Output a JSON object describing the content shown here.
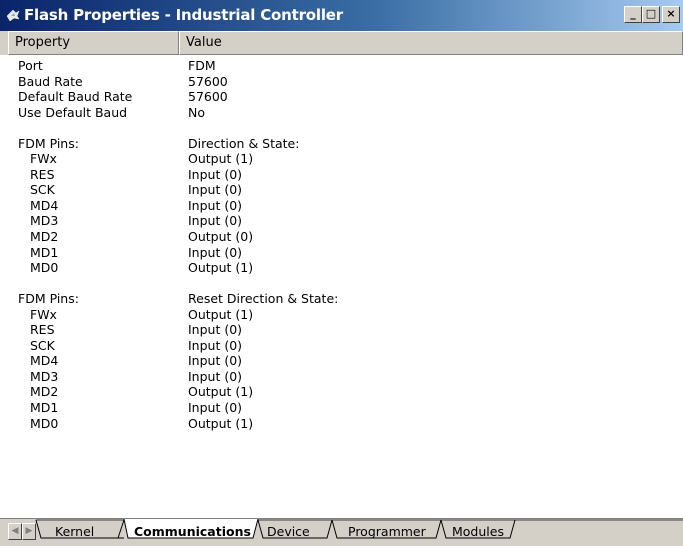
{
  "window": {
    "title": "Flash Properties - Industrial Controller"
  },
  "columns": {
    "property": "Property",
    "value": "Value"
  },
  "rows": [
    {
      "property": "Port",
      "value": "FDM"
    },
    {
      "property": "Baud Rate",
      "value": "57600"
    },
    {
      "property": "Default Baud Rate",
      "value": "57600"
    },
    {
      "property": "Use Default Baud",
      "value": "No"
    },
    {
      "property": "",
      "value": ""
    },
    {
      "property": "FDM Pins:",
      "value": "Direction & State:"
    },
    {
      "property": "FWx",
      "value": "Output (1)"
    },
    {
      "property": "RES",
      "value": "Input (0)"
    },
    {
      "property": "SCK",
      "value": "Input (0)"
    },
    {
      "property": "MD4",
      "value": "Input (0)"
    },
    {
      "property": "MD3",
      "value": "Input (0)"
    },
    {
      "property": "MD2",
      "value": "Output (0)"
    },
    {
      "property": "MD1",
      "value": "Input (0)"
    },
    {
      "property": "MD0",
      "value": "Output (1)"
    },
    {
      "property": "",
      "value": ""
    },
    {
      "property": "FDM Pins:",
      "value": "Reset Direction & State:"
    },
    {
      "property": "FWx",
      "value": "Output (1)"
    },
    {
      "property": "RES",
      "value": "Input (0)"
    },
    {
      "property": "SCK",
      "value": "Input (0)"
    },
    {
      "property": "MD4",
      "value": "Input (0)"
    },
    {
      "property": "MD3",
      "value": "Input (0)"
    },
    {
      "property": "MD2",
      "value": "Output (1)"
    },
    {
      "property": "MD1",
      "value": "Input (0)"
    },
    {
      "property": "MD0",
      "value": "Output (1)"
    }
  ],
  "tabs": [
    {
      "label": "Kernel",
      "active": false
    },
    {
      "label": "Communications",
      "active": true
    },
    {
      "label": "Device",
      "active": false
    },
    {
      "label": "Programmer",
      "active": false
    },
    {
      "label": "Modules",
      "active": false
    }
  ],
  "icons": {
    "app": "flash-chip-icon",
    "minimize": "minimize-icon",
    "maximize": "maximize-icon",
    "close": "close-icon",
    "scroll_left": "scroll-left-icon",
    "scroll_right": "scroll-right-icon"
  },
  "colors": {
    "titlebar_start": "#0a246a",
    "titlebar_end": "#a6caf0",
    "face": "#d4d0c8"
  }
}
